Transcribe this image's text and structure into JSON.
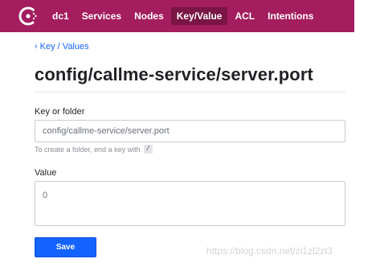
{
  "colors": {
    "brand": "#a41d5e",
    "nav_active": "#7a1546",
    "link": "#1563ff",
    "primary_button": "#1563ff"
  },
  "nav": {
    "logo_icon": "consul-logo-icon",
    "datacenter": "dc1",
    "items": [
      {
        "label": "Services",
        "active": false
      },
      {
        "label": "Nodes",
        "active": false
      },
      {
        "label": "Key/Value",
        "active": true
      },
      {
        "label": "ACL",
        "active": false
      },
      {
        "label": "Intentions",
        "active": false
      }
    ]
  },
  "breadcrumb": {
    "icon": "chevron-left-icon",
    "label": "Key / Values"
  },
  "page": {
    "title": "config/callme-service/server.port"
  },
  "form": {
    "key_label": "Key or folder",
    "key_value": "config/callme-service/server.port",
    "hint_text": "To create a folder, end a key with",
    "hint_code": "/",
    "value_label": "Value",
    "value": "0",
    "save_label": "Save"
  },
  "watermark": "https://blog.csdn.net/zl1zl2zl3"
}
